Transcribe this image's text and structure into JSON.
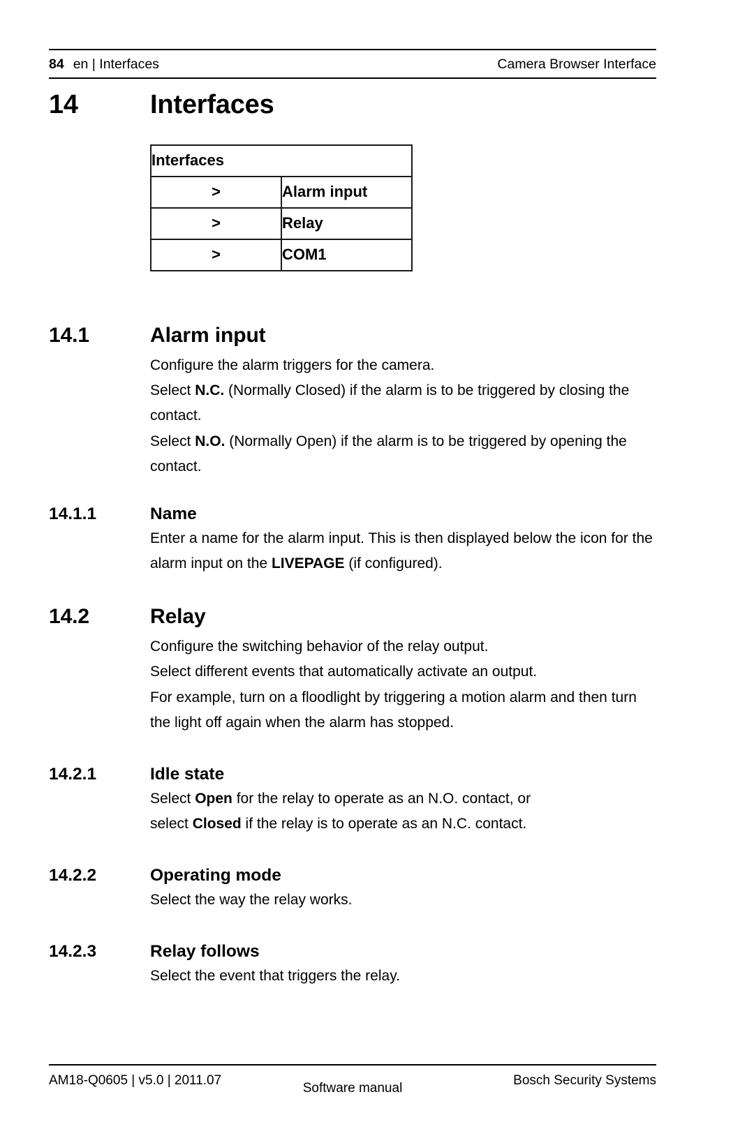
{
  "header": {
    "page_number": "84",
    "breadcrumb": "en | Interfaces",
    "manual_title": "Camera Browser Interface"
  },
  "chapter": {
    "number": "14",
    "title": "Interfaces"
  },
  "menu_table": {
    "header": "Interfaces",
    "arrow": ">",
    "rows": [
      {
        "arrow": ">",
        "label": "Alarm input"
      },
      {
        "arrow": ">",
        "label": "Relay"
      },
      {
        "arrow": ">",
        "label": "COM1"
      }
    ]
  },
  "sections": [
    {
      "number": "14.1",
      "title": "Alarm input",
      "paragraphs": [
        {
          "prefix": "Configure the alarm triggers for the camera.",
          "bold": "",
          "suffix": ""
        },
        {
          "prefix": "Select ",
          "bold": "N.C.",
          "suffix": " (Normally Closed) if the alarm is to be triggered by closing the contact."
        },
        {
          "prefix": "Select ",
          "bold": "N.O.",
          "suffix": " (Normally Open) if the alarm is to be triggered by opening the contact."
        }
      ]
    },
    {
      "number": "14.1.1",
      "title": "Name",
      "paragraphs": [
        {
          "prefix": "Enter a name for the alarm input. This is then displayed below the icon for the alarm input on the ",
          "bold": "LIVEPAGE",
          "suffix": " (if configured)."
        }
      ]
    },
    {
      "number": "14.2",
      "title": "Relay",
      "paragraphs": [
        {
          "prefix": "Configure the switching behavior of the relay output.",
          "bold": "",
          "suffix": ""
        },
        {
          "prefix": "Select different events that automatically activate an output.",
          "bold": "",
          "suffix": ""
        },
        {
          "prefix": "For example, turn on a floodlight by triggering a motion alarm and then turn the light off again when the alarm has stopped.",
          "bold": "",
          "suffix": ""
        }
      ]
    },
    {
      "number": "14.2.1",
      "title": "Idle state",
      "paragraphs": [
        {
          "prefix": "Select ",
          "bold": "Open",
          "suffix": " for the relay to operate as an N.O. contact, or"
        },
        {
          "prefix": "select ",
          "bold": "Closed",
          "suffix": " if the relay is to operate as an N.C. contact."
        }
      ]
    },
    {
      "number": "14.2.2",
      "title": "Operating mode",
      "paragraphs": [
        {
          "prefix": "Select the way the relay works.",
          "bold": "",
          "suffix": ""
        }
      ]
    },
    {
      "number": "14.2.3",
      "title": "Relay follows",
      "paragraphs": [
        {
          "prefix": "Select the event that triggers the relay.",
          "bold": "",
          "suffix": ""
        }
      ]
    }
  ],
  "footer": {
    "doc_id": "AM18-Q0605 | v5.0 | 2011.07",
    "center": "Software manual",
    "publisher": "Bosch Security Systems"
  }
}
